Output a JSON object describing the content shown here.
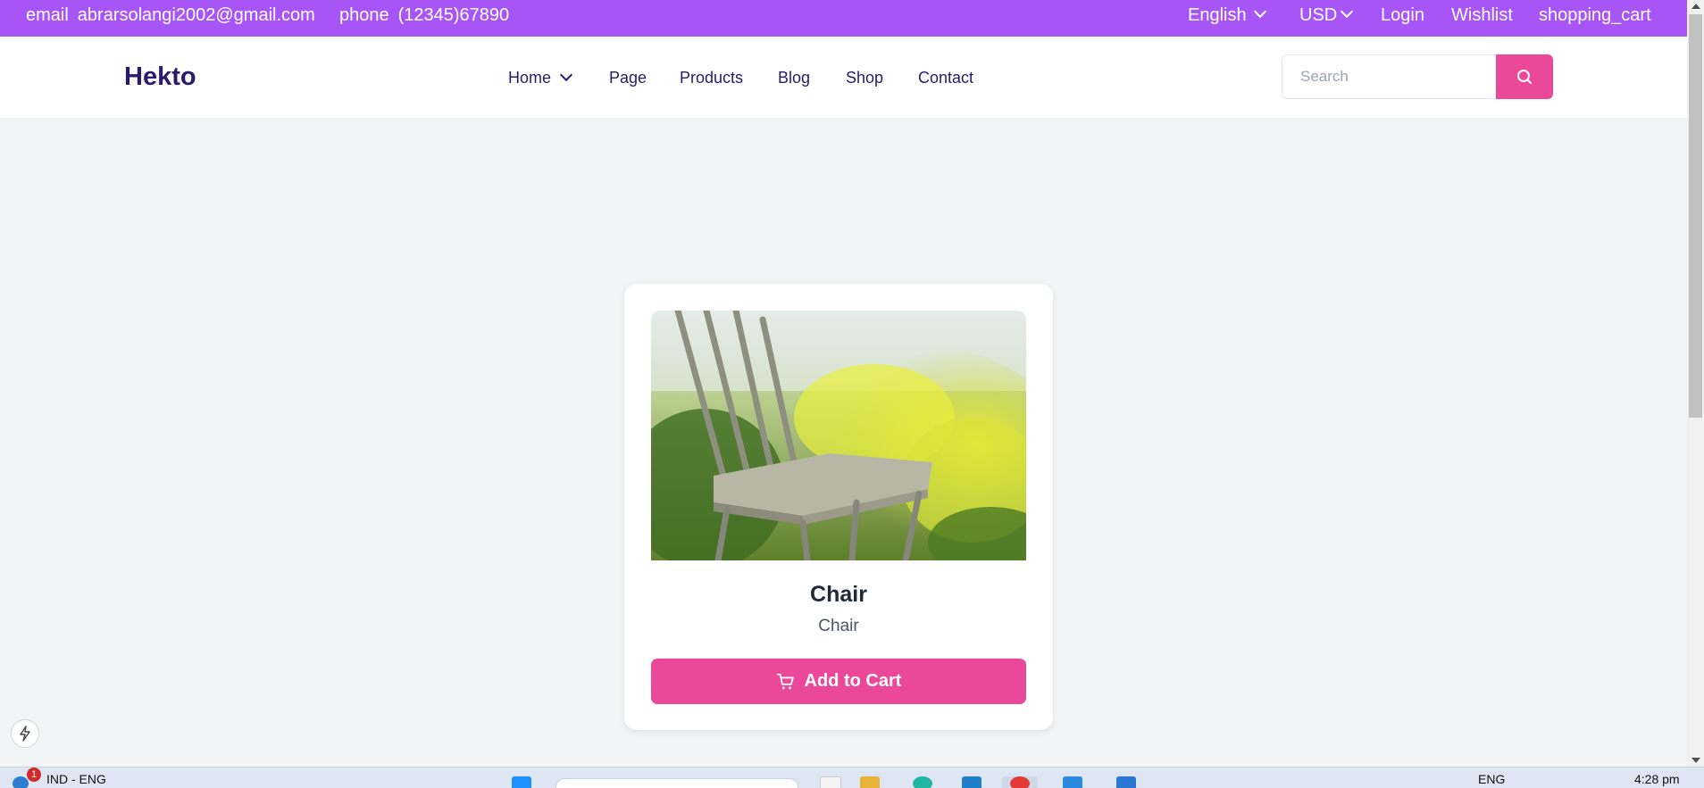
{
  "topbar": {
    "email_icon": "email",
    "email": "abrarsolangi2002@gmail.com",
    "phone_icon": "phone",
    "phone": "(12345)67890",
    "language": "English",
    "currency": "USD",
    "login": "Login",
    "wishlist": "Wishlist",
    "cart": "shopping_cart",
    "color": "#a855f7"
  },
  "nav": {
    "logo": "Hekto",
    "items": [
      "Home",
      "Page",
      "Products",
      "Blog",
      "Shop",
      "Contact"
    ],
    "search_placeholder": "Search",
    "search_icon": "search-icon"
  },
  "product": {
    "title": "Chair",
    "subtitle": "Chair",
    "button_label": "Add to Cart",
    "button_icon": "cart-icon",
    "accent": "#ec4899"
  },
  "taskbar": {
    "notification_count": "1",
    "input_lang": "IND - ENG",
    "tray_lang": "ENG",
    "time": "4:28 pm"
  }
}
